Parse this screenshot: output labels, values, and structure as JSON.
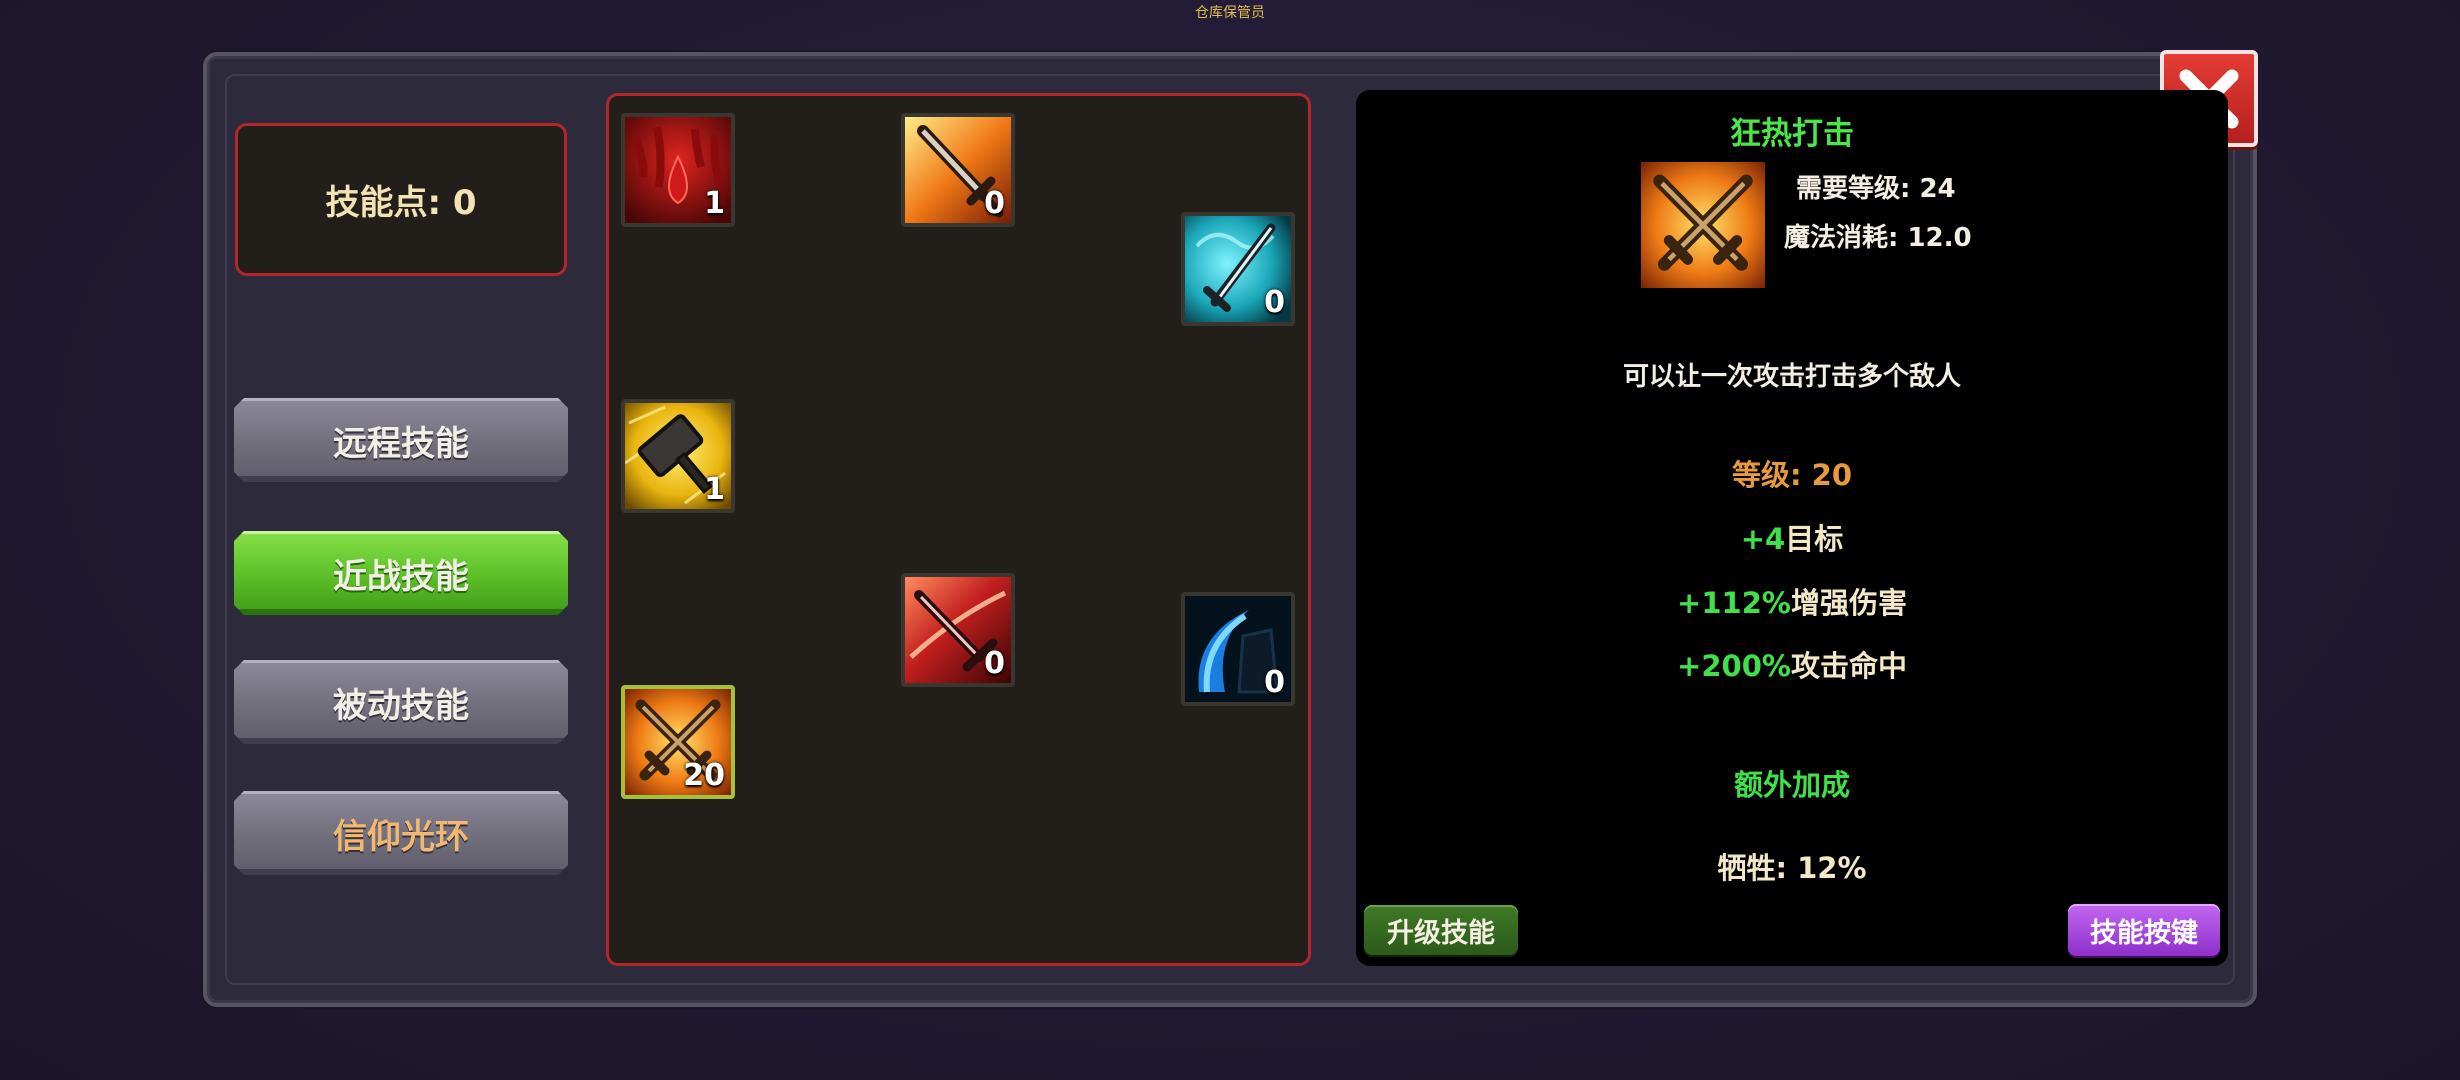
{
  "window_title": "仓库保管员",
  "skill_points": "技能点: 0",
  "tabs": [
    {
      "label": "远程技能",
      "active": false
    },
    {
      "label": "近战技能",
      "active": true
    },
    {
      "label": "被动技能",
      "active": false
    },
    {
      "label": "信仰光环",
      "active": false
    }
  ],
  "skills": [
    {
      "icon": "blood-drop-icon",
      "level": "1"
    },
    {
      "icon": "flaming-sword-icon",
      "level": "0"
    },
    {
      "icon": "frost-sword-icon",
      "level": "0"
    },
    {
      "icon": "war-hammer-icon",
      "level": "1"
    },
    {
      "icon": "crimson-slash-icon",
      "level": "0"
    },
    {
      "icon": "blue-crescent-icon",
      "level": "0"
    },
    {
      "icon": "crossed-swords-icon",
      "level": "20",
      "selected": true
    }
  ],
  "detail": {
    "name": "狂热打击",
    "icon": "crossed-swords-icon",
    "required_level": "需要等级: 24",
    "mana_cost": "魔法消耗: 12.0",
    "description": "可以让一次攻击打击多个敌人",
    "level": "等级: 20",
    "bonuses": [
      {
        "value": "+4",
        "label": "目标"
      },
      {
        "value": "+112%",
        "label": "增强伤害"
      },
      {
        "value": "+200%",
        "label": "攻击命中"
      }
    ],
    "extra_heading": "额外加成",
    "sacrifice": "牺牲: 12%"
  },
  "buttons": {
    "upgrade": "升级技能",
    "keybind": "技能按键"
  },
  "colors": {
    "accent_green": "#3fe04a",
    "panel_border_red": "#b3262e",
    "keybind_purple": "#b054e8"
  }
}
